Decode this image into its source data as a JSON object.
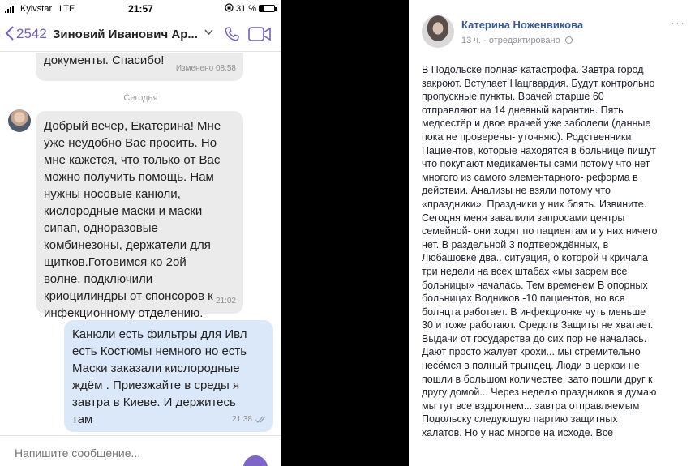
{
  "status_bar": {
    "carrier": "Kyivstar",
    "network": "LTE",
    "time": "21:57",
    "battery": "31 %"
  },
  "chat_header": {
    "back_count": "2542",
    "contact_name": "Зиновий Иванович Ар...",
    "icons": [
      "chevron-left-icon",
      "chevron-down-icon",
      "phone-icon",
      "video-icon"
    ],
    "accent_color": "#6f5fc9"
  },
  "messages": {
    "prev_incoming": {
      "text": "документы. Спасибо!",
      "time": "Изменено 08:58"
    },
    "day_separator": "Сегодня",
    "incoming": {
      "lines": [
        "Добрый вечер, Екатерина! Мне",
        "уже неудобно Вас просить. Но",
        "мне кажется, что только от Вас",
        "можно получить помощь. Нам",
        "нужны носовые канюли,",
        "кислородные маски и маски",
        "сипап, одноразовые",
        "комбинезоны, держатели для",
        "щитков.Готовимся ко 2ой",
        "волне, подключили",
        "криоцилиндры от спонсоров к",
        "инфекционному отделению."
      ],
      "time": "21:02"
    },
    "outgoing": {
      "lines": [
        "Канюли есть фильтры  для Ивл",
        "есть  Костюмы немного но есть",
        "Маски заказали кислородные",
        "ждём . Приезжайте в среды я",
        "завтра в Киеве. И держитесь",
        "там"
      ],
      "time": "21:38",
      "bubble_color": "#dbe8fa"
    }
  },
  "input": {
    "placeholder": "Напишите сообщение..."
  },
  "post": {
    "author": "Катерина Ноженвикова",
    "time_ago": "13 ч.",
    "edited": "· отредактировано",
    "menu_icon": "more-dots-icon",
    "lines": [
      "В Подольске полная катастрофа. Завтра город",
      "закроют. Вступает Нацгвардия. Будут контрольно",
      "пропускные пункты. Врачей старше 60",
      "отправляют на 14 дневный карантин. Пять",
      "медсестёр и двое врачей уже заболели (данные",
      "пока не проверены- уточняю). Родственники",
      "Пациентов, которые находятся в больнице пишут",
      "что покупают медикаменты сами потому что нет",
      "многого из самого элементарного- реформа в",
      "действии. Анализы не взяли потому что",
      "«праздники». Праздники у них блять. Извините.",
      "Сегодня меня завалили запросами центры",
      "семейной- они ходят по пациентам и у них ничего",
      "нет. В раздельной 3 подтверждённых, в",
      "Любашовке два.. ситуация, о которой ч кричала",
      "три недели на всех штабах «мы засрем все",
      "больницы» началась. Тем временем В опорных",
      "больницах Водников -10 пациентов, но вся",
      "болнцта работает. В инфекционке чуть меньше",
      "30 и тоже работают. Средств Защиты не хватает.",
      "Выдачи от государства до сих пор не началась.",
      "Дают просто жалует крохи... мы стремительно",
      "несёмся в полный трындец. Люди в церкви не",
      "пошли в большом количестве, зато пошли друг к",
      "другу домой... Через неделю праздников я думаю",
      "мы тут все вздрогнем... завтра отправляемым",
      "Подольску следующую партию защитных",
      "халатов. Но у нас многое на исходе. Все"
    ],
    "author_color": "#385898"
  }
}
